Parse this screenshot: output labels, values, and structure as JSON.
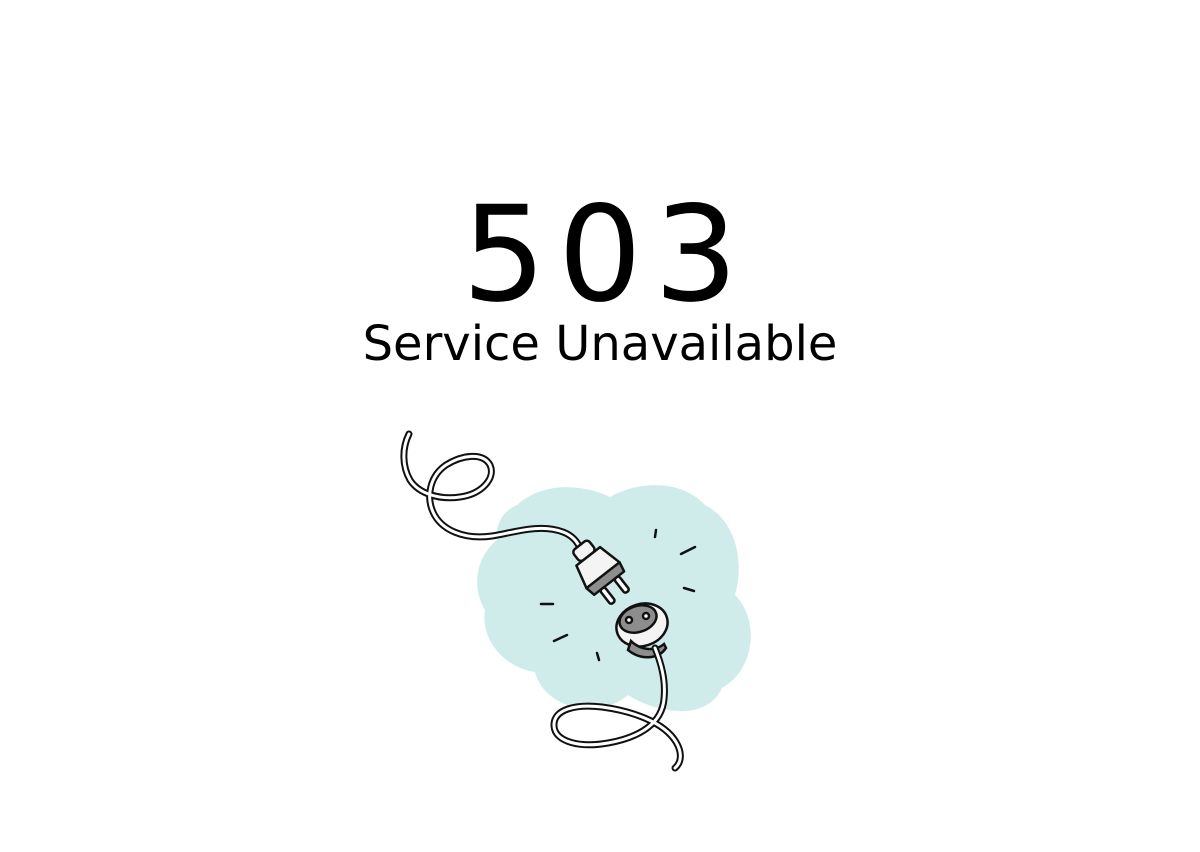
{
  "error": {
    "code": "503",
    "message": "Service Unavailable"
  },
  "illustration": {
    "icon": "unplugged-cable-icon",
    "blob_color": "#cfeceb",
    "line_color": "#111111",
    "plug_color": "#f4f4f4",
    "plug_shade_color": "#8d8d8d"
  }
}
